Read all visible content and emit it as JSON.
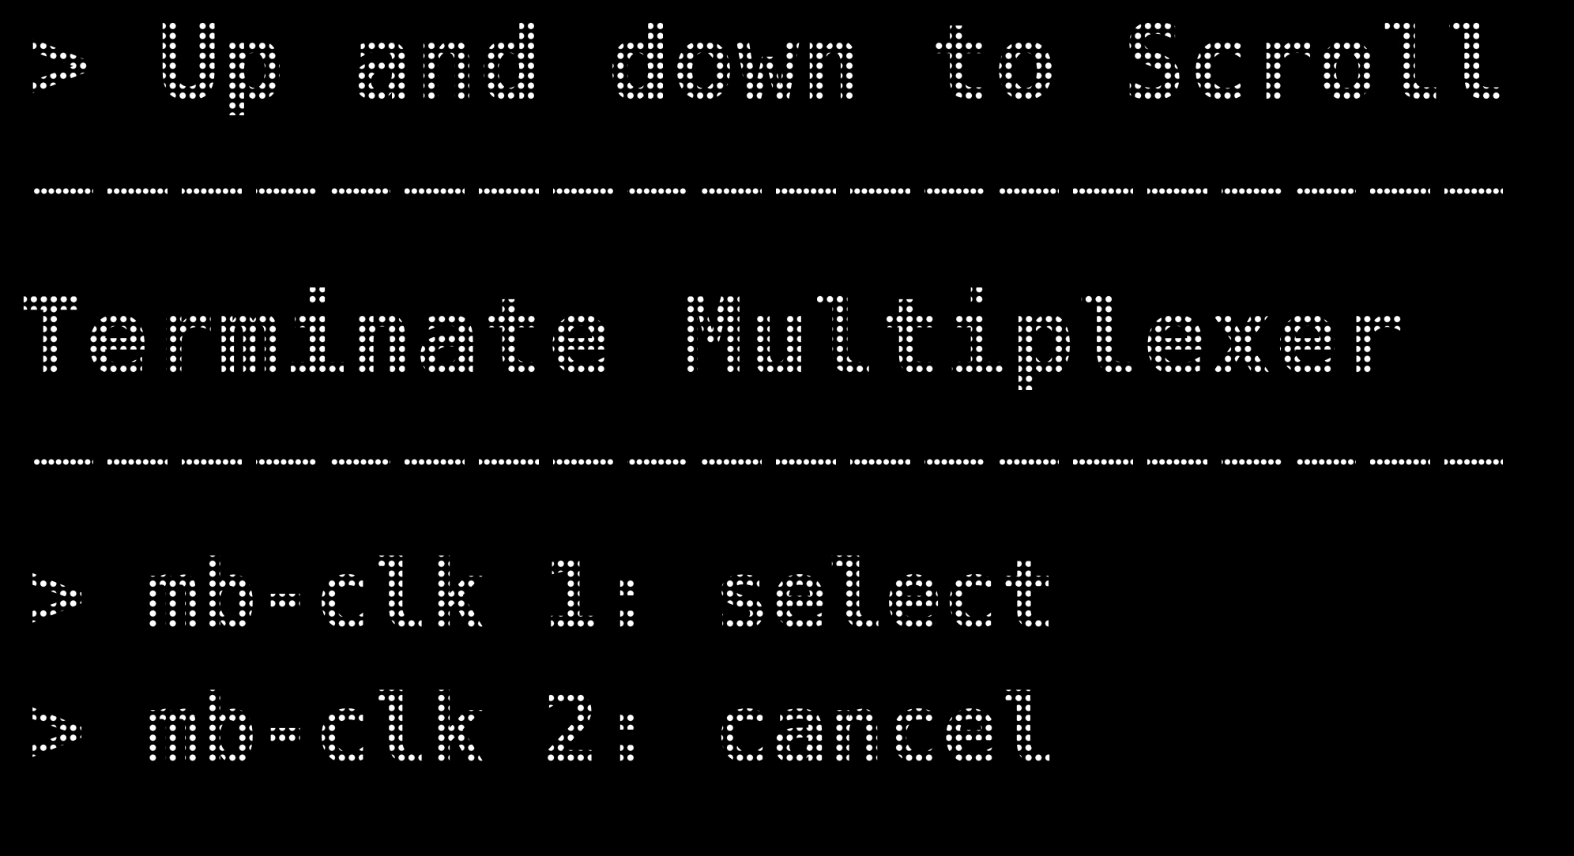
{
  "menu": {
    "scroll_hint": "> Up and down to Scroll",
    "title": "Terminate Multiplexer",
    "options": [
      {
        "label": "> mb-clk 1: select"
      },
      {
        "label": "> mb-clk 2: cancel"
      }
    ]
  },
  "colors": {
    "background": "#000000",
    "text": "#ffffff"
  }
}
